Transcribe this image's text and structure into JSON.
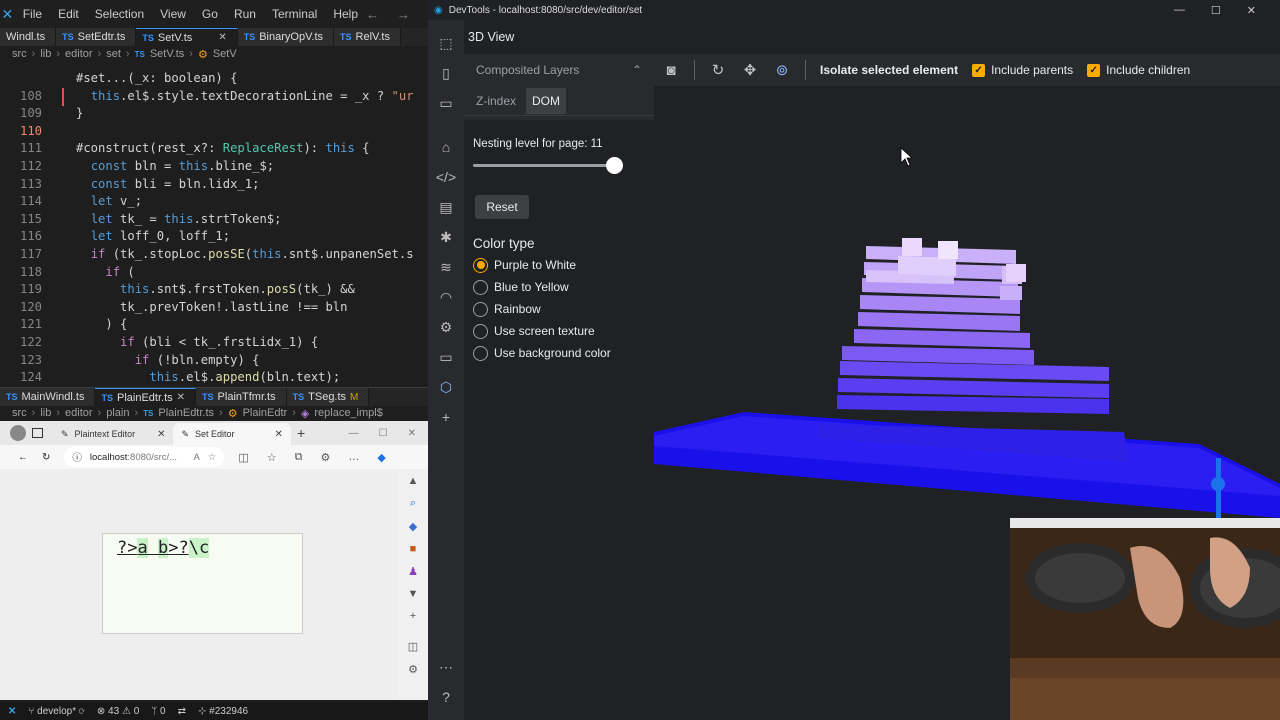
{
  "vscode": {
    "menu": [
      "File",
      "Edit",
      "Selection",
      "View",
      "Go",
      "Run",
      "Terminal",
      "Help"
    ],
    "tabs_top": [
      {
        "label": "Windl.ts",
        "prefix": "",
        "close": false,
        "active": false
      },
      {
        "label": "SetEdtr.ts",
        "prefix": "TS",
        "close": false,
        "active": false
      },
      {
        "label": "SetV.ts",
        "prefix": "TS",
        "close": true,
        "active": true
      },
      {
        "label": "BinaryOpV.ts",
        "prefix": "TS",
        "close": false,
        "active": false
      },
      {
        "label": "RelV.ts",
        "prefix": "TS",
        "close": false,
        "active": false
      }
    ],
    "crumbs_top": [
      "src",
      "lib",
      "editor",
      "set",
      "SetV.ts",
      "SetV"
    ],
    "code_lines": [
      {
        "n": "",
        "t": "#set...(_x: boolean) {"
      },
      {
        "n": "108",
        "t": "  this.el$.style.textDecorationLine = _x ? \"ur"
      },
      {
        "n": "109",
        "t": "}"
      },
      {
        "n": "110",
        "t": ""
      },
      {
        "n": "111",
        "t": "#construct(rest_x?: ReplaceRest): this {"
      },
      {
        "n": "112",
        "t": "  const bln = this.bline_$;"
      },
      {
        "n": "113",
        "t": "  const bli = bln.lidx_1;"
      },
      {
        "n": "114",
        "t": "  let v_;"
      },
      {
        "n": "115",
        "t": "  let tk_ = this.strtToken$;"
      },
      {
        "n": "116",
        "t": "  let loff_0, loff_1;"
      },
      {
        "n": "117",
        "t": "  if (tk_.stopLoc.posSE(this.snt$.unpanenSet.s"
      },
      {
        "n": "118",
        "t": "    if ("
      },
      {
        "n": "119",
        "t": "      this.snt$.frstToken.posS(tk_) &&"
      },
      {
        "n": "120",
        "t": "      tk_.prevToken!.lastLine !== bln"
      },
      {
        "n": "121",
        "t": "    ) {"
      },
      {
        "n": "122",
        "t": "      if (bli < tk_.frstLidx_1) {"
      },
      {
        "n": "123",
        "t": "        if (!bln.empty) {"
      },
      {
        "n": "124",
        "t": "          this.el$.append(bln.text);"
      },
      {
        "n": "125",
        "t": "        }"
      }
    ],
    "tabs_bottom": [
      {
        "label": "MainWindl.ts",
        "prefix": "TS",
        "close": false,
        "active": false,
        "mod": ""
      },
      {
        "label": "PlainEdtr.ts",
        "prefix": "TS",
        "close": true,
        "active": true,
        "mod": ""
      },
      {
        "label": "PlainTfmr.ts",
        "prefix": "TS",
        "close": false,
        "active": false,
        "mod": ""
      },
      {
        "label": "TSeg.ts",
        "prefix": "TS",
        "close": false,
        "active": false,
        "mod": "M"
      }
    ],
    "crumbs_bottom": [
      "src",
      "lib",
      "editor",
      "plain",
      "PlainEdtr.ts",
      "PlainEdtr",
      "replace_impl$"
    ],
    "status": {
      "branch": "develop*",
      "problems": "43",
      "warnings": "0",
      "ports": "0",
      "pr": "#232946"
    }
  },
  "edge": {
    "tabs": [
      {
        "label": "Plaintext Editor",
        "active": false
      },
      {
        "label": "Set Editor",
        "active": true
      }
    ],
    "url_host": "localhost",
    "url_rest": ":8080/src/...",
    "set_text": {
      "a": "?>",
      "b": "a",
      "c": " ",
      "d": "b",
      "e": ">?",
      "f": "\\c"
    }
  },
  "devtools": {
    "window_title": "DevTools - localhost:8080/src/dev/editor/set",
    "view_title": "3D View",
    "layers_label": "Composited Layers",
    "subtabs": [
      "Z-index",
      "DOM"
    ],
    "nesting_label": "Nesting level for page: 11",
    "nesting_value": 11,
    "nesting_fraction": 0.96,
    "reset_label": "Reset",
    "color_type_label": "Color type",
    "color_options": [
      {
        "label": "Purple to White",
        "selected": true
      },
      {
        "label": "Blue to Yellow",
        "selected": false
      },
      {
        "label": "Rainbow",
        "selected": false
      },
      {
        "label": "Use screen texture",
        "selected": false
      },
      {
        "label": "Use background color",
        "selected": false
      }
    ],
    "isolate_label": "Isolate selected element",
    "include_parents": "Include parents",
    "include_children": "Include children",
    "accent": "#f9ab00"
  }
}
